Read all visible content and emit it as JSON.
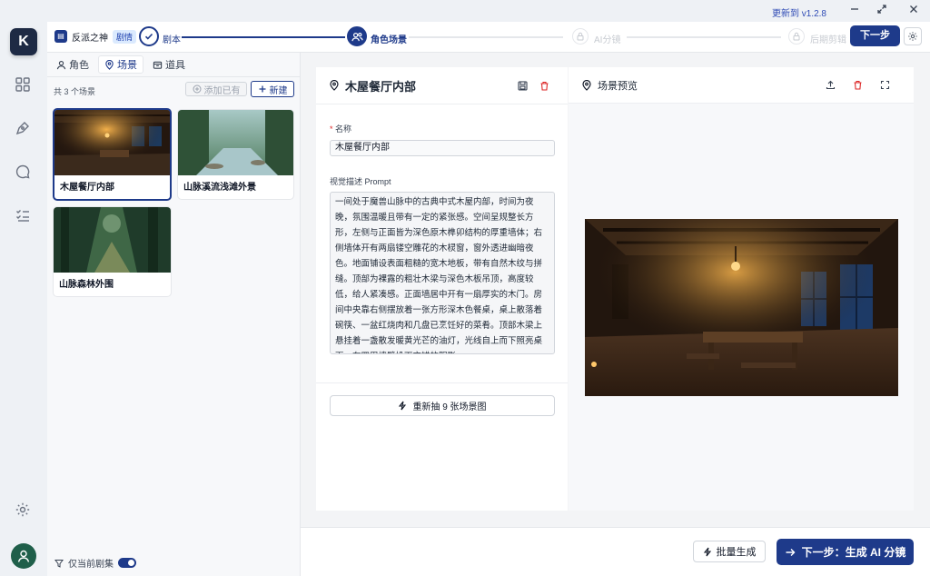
{
  "titlebar": {
    "update_label": "更新到 v1.2.8"
  },
  "rail": {
    "logo_letter": "K"
  },
  "project": {
    "name": "反派之神",
    "tag": "剧情"
  },
  "steps": [
    {
      "label": "剧本",
      "state": "done"
    },
    {
      "label": "角色场景",
      "state": "active"
    },
    {
      "label": "AI分镜",
      "state": "locked"
    },
    {
      "label": "后期剪辑",
      "state": "locked"
    }
  ],
  "header": {
    "next_label": "下一步"
  },
  "left": {
    "tabs": [
      {
        "label": "角色",
        "icon": "user-icon",
        "active": false
      },
      {
        "label": "场景",
        "icon": "map-pin-icon",
        "active": true
      },
      {
        "label": "道具",
        "icon": "box-icon",
        "active": false
      }
    ],
    "count_label": "共 3 个场景",
    "add_existing_label": "添加已有",
    "new_label": "新建",
    "scenes": [
      {
        "title": "木屋餐厅内部",
        "selected": true
      },
      {
        "title": "山脉溪流浅滩外景",
        "selected": false
      },
      {
        "title": "山脉森林外围",
        "selected": false
      }
    ],
    "filter_label": "仅当前剧集",
    "filter_on": true
  },
  "editor": {
    "title": "木屋餐厅内部",
    "name_label": "名称",
    "name_value": "木屋餐厅内部",
    "prompt_label": "视觉描述 Prompt",
    "prompt_value": "一间处于魔兽山脉中的古典中式木屋内部，时间为夜晚，氛围温暖且带有一定的紧张感。空间呈规整长方形，左侧与正面皆为深色原木榫卯结构的厚重墙体；右侧墙体开有两扇镂空雕花的木棂窗，窗外透进幽暗夜色。地面铺设表面粗糙的宽木地板，带有自然木纹与拼缝。顶部为裸露的粗壮木梁与深色木板吊顶，高度较低，给人紧凑感。正面墙居中开有一扇厚实的木门。房间中央靠右侧摆放着一张方形深木色餐桌，桌上散落着碗筷、一盆红烧肉和几盘已烹饪好的菜肴。顶部木梁上悬挂着一盏散发暖黄光芒的油灯，光线自上而下照亮桌面，在四周墙壁投下交错的阴影。",
    "regen_label": "重新抽 9 张场景图"
  },
  "preview": {
    "title": "场景预览"
  },
  "footer": {
    "batch_label": "批量生成",
    "next_label": "下一步：生成 AI 分镜"
  },
  "colors": {
    "accent": "#1e3a8a",
    "danger": "#dc2626",
    "tag_bg": "#dbeafe"
  }
}
